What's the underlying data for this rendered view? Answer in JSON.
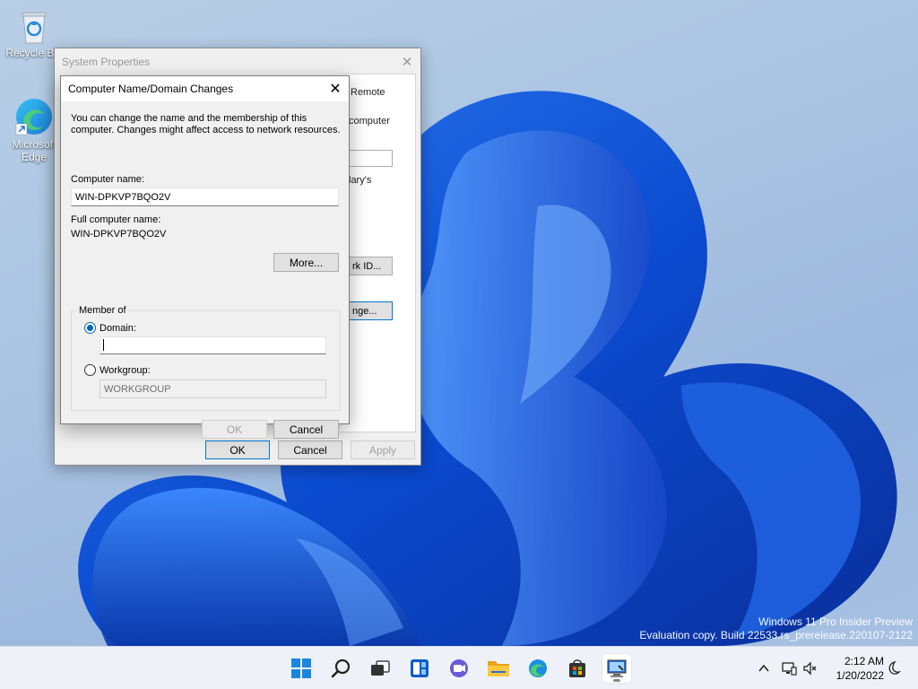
{
  "desktop": {
    "icons": [
      {
        "label": "Recycle Bin"
      },
      {
        "label": "Microsoft Edge"
      }
    ],
    "watermark": {
      "line1": "Windows 11 Pro Insider Preview",
      "line2": "Evaluation copy. Build 22533.rs_prerelease.220107-2122"
    }
  },
  "system_properties": {
    "title": "System Properties",
    "fragments": {
      "tab_remote": "Remote",
      "computer": "computer",
      "lary_s": "lary's",
      "network_id": "rk ID...",
      "change": "nge..."
    },
    "buttons": {
      "ok": "OK",
      "cancel": "Cancel",
      "apply": "Apply"
    }
  },
  "dialog": {
    "title": "Computer Name/Domain Changes",
    "description_line1": "You can change the name and the membership of this",
    "description_line2": "computer. Changes might affect access to network resources.",
    "computer_name_label": "Computer name:",
    "computer_name_value": "WIN-DPKVP7BQO2V",
    "full_name_label": "Full computer name:",
    "full_name_value": "WIN-DPKVP7BQO2V",
    "more_button": "More...",
    "member_of_label": "Member of",
    "domain_label": "Domain:",
    "domain_value": "",
    "workgroup_label": "Workgroup:",
    "workgroup_value": "WORKGROUP",
    "ok_button": "OK",
    "cancel_button": "Cancel"
  },
  "taskbar": {
    "time": "2:12 AM",
    "date": "1/20/2022"
  },
  "colors": {
    "accent": "#0067c0",
    "wallpaper_blue": "#1a5fd6"
  }
}
